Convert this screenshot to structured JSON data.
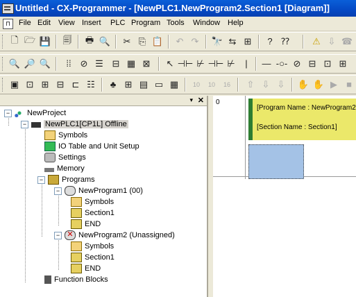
{
  "window": {
    "title": "Untitled - CX-Programmer - [NewPLC1.NewProgram2.Section1 [Diagram]]"
  },
  "menu": [
    "File",
    "Edit",
    "View",
    "Insert",
    "PLC",
    "Program",
    "Tools",
    "Window",
    "Help"
  ],
  "toolbar1": [
    "new-icon",
    "open-icon",
    "save-icon",
    "print-preview-icon",
    "print-icon",
    "preview-icon",
    "cut-icon",
    "copy-icon",
    "paste-icon",
    "undo-icon",
    "redo-icon",
    "find-icon",
    "replace-icon",
    "grid-icon",
    "help-icon",
    "context-help-icon",
    "warning-icon",
    "download-icon",
    "phone-icon"
  ],
  "toolbar2": [
    "zoom-icon",
    "zoom-in-icon",
    "zoom-out-icon",
    "grid-toggle-icon",
    "monitor-icon",
    "list-icon",
    "contact-open-icon",
    "contact-closed-icon",
    "select-icon",
    "contact-no-icon",
    "contact-nc-icon",
    "contact-or-icon",
    "contact-orn-icon",
    "vertical-line-icon",
    "horizontal-line-icon",
    "coil-icon",
    "coil-nc-icon",
    "instruction-icon",
    "function-block-icon"
  ],
  "toolbar3": [
    "window-icon",
    "ladder-icon",
    "cross-ref-icon",
    "address-icon",
    "comment-icon",
    "properties-icon",
    "network-icon",
    "io-icon",
    "memory-icon",
    "table-icon",
    "step-10-icon",
    "step-10b-icon",
    "step-16-icon",
    "transfer-icon",
    "transfer2-icon",
    "transfer3-icon",
    "online-icon",
    "online2-icon",
    "run-icon",
    "stop-icon"
  ],
  "toolbar3_text": {
    "b10a": "10",
    "b10b": "10",
    "b16": "16"
  },
  "tree": {
    "project": "NewProject",
    "plc": "NewPLC1[CP1L] Offline",
    "symbols": "Symbols",
    "io_table": "IO Table and Unit Setup",
    "settings": "Settings",
    "memory": "Memory",
    "programs": "Programs",
    "program1": "NewProgram1 (00)",
    "p1_symbols": "Symbols",
    "p1_section1": "Section1",
    "p1_end": "END",
    "program2": "NewProgram2 (Unassigned)",
    "p2_symbols": "Symbols",
    "p2_section1": "Section1",
    "p2_end": "END",
    "function_blocks": "Function Blocks"
  },
  "diagram": {
    "rung_number": "0",
    "program_comment": "[Program Name : NewProgram2]",
    "section_comment": "[Section Name : Section1]"
  }
}
